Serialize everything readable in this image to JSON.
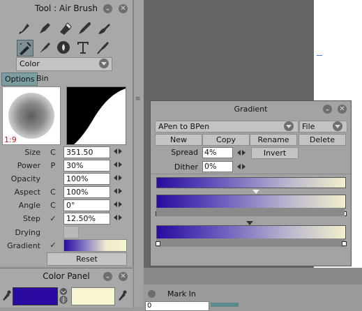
{
  "tool_panel": {
    "title": "Tool : Air Brush",
    "color_mode": "Color",
    "tabs": [
      "Options",
      "Bin"
    ],
    "brush_ratio": "1:9",
    "properties": [
      {
        "label": "Size",
        "mode": "C",
        "value": "351.50"
      },
      {
        "label": "Power",
        "mode": "P",
        "value": "30%"
      },
      {
        "label": "Opacity",
        "mode": "",
        "value": "100%"
      },
      {
        "label": "Aspect",
        "mode": "C",
        "value": "100%"
      },
      {
        "label": "Angle",
        "mode": "C",
        "value": "0°"
      },
      {
        "label": "Step",
        "mode": "✓",
        "value": "12.50%"
      }
    ],
    "drying_label": "Drying",
    "gradient_label": "Gradient",
    "gradient_check": "✓",
    "reset_label": "Reset"
  },
  "color_panel": {
    "title": "Color Panel",
    "primary_color": "#2a0aa0",
    "secondary_color": "#f8f6d0"
  },
  "gradient_dialog": {
    "title": "Gradient",
    "preset": "APen to BPen",
    "file_menu": "File",
    "buttons": [
      "New",
      "Copy",
      "Rename",
      "Delete"
    ],
    "spread_label": "Spread",
    "spread_value": "4%",
    "invert_label": "Invert",
    "dither_label": "Dither",
    "dither_value": "0%"
  },
  "bottom_bar": {
    "mark_in_label": "Mark In",
    "frame_value": "0"
  }
}
